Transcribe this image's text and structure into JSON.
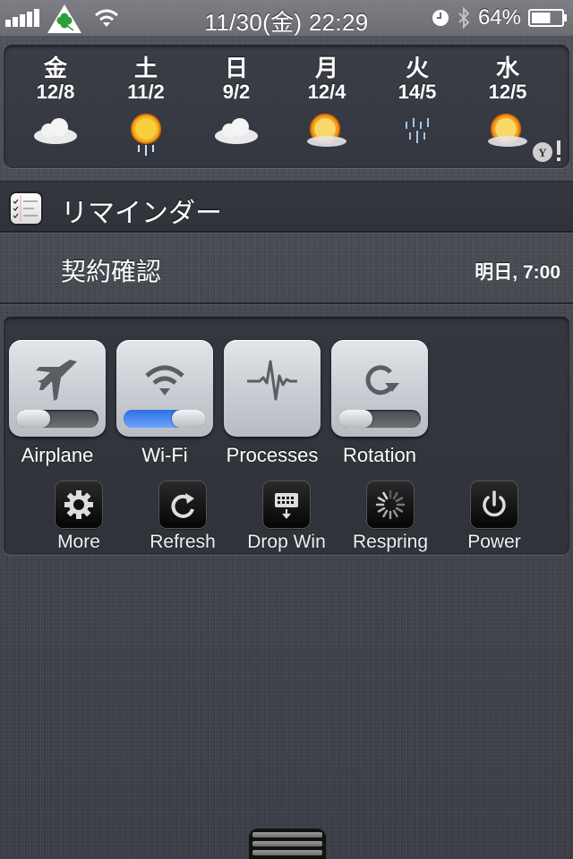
{
  "status_bar": {
    "signal_icon": "signal-bars-icon",
    "carrier_icon": "clover-carrier-icon",
    "wifi_icon": "wifi-icon",
    "datetime": "11/30(金) 22:29",
    "alarm_icon": "clock-icon",
    "bluetooth_icon": "bluetooth-icon",
    "battery_percent": "64%",
    "battery_level": 0.64
  },
  "weather": {
    "days": [
      {
        "name": "金",
        "temps": "12/8",
        "condition": "cloudy"
      },
      {
        "name": "土",
        "temps": "11/2",
        "condition": "sun-rain"
      },
      {
        "name": "日",
        "temps": "9/2",
        "condition": "cloudy"
      },
      {
        "name": "月",
        "temps": "12/4",
        "condition": "sun-cloud"
      },
      {
        "name": "火",
        "temps": "14/5",
        "condition": "rain"
      },
      {
        "name": "水",
        "temps": "12/5",
        "condition": "sun-cloud"
      }
    ],
    "provider_badge": "Y!"
  },
  "reminders": {
    "title": "リマインダー",
    "items": [
      {
        "title": "契約確認",
        "due": "明日, 7:00"
      }
    ]
  },
  "toggles": [
    {
      "label": "Airplane",
      "icon": "airplane-icon",
      "on": false,
      "has_switch": true
    },
    {
      "label": "Wi-Fi",
      "icon": "wifi-icon",
      "on": true,
      "has_switch": true
    },
    {
      "label": "Processes",
      "icon": "pulse-icon",
      "on": false,
      "has_switch": false
    },
    {
      "label": "Rotation",
      "icon": "rotation-icon",
      "on": false,
      "has_switch": true
    }
  ],
  "actions": [
    {
      "label": "More",
      "icon": "gear-icon"
    },
    {
      "label": "Refresh",
      "icon": "refresh-icon"
    },
    {
      "label": "Drop Win",
      "icon": "drop-window-icon"
    },
    {
      "label": "Respring",
      "icon": "spinner-icon"
    },
    {
      "label": "Power",
      "icon": "power-icon"
    }
  ],
  "colors": {
    "accent_blue": "#3d7ff0",
    "background": "#3c3f47"
  }
}
